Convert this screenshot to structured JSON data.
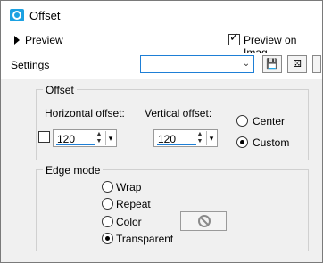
{
  "window": {
    "title": "Offset"
  },
  "top": {
    "preview_toggle": "Preview",
    "preview_on_image": "Preview on Imag",
    "preview_on_image_checked": true
  },
  "settings": {
    "label": "Settings",
    "selected_value": ""
  },
  "offset_group": {
    "legend": "Offset",
    "horizontal_label": "Horizontal offset:",
    "vertical_label": "Vertical offset:",
    "horizontal_value": "120",
    "vertical_value": "120",
    "link_checked": false,
    "options": [
      {
        "label": "Center",
        "selected": false
      },
      {
        "label": "Custom",
        "selected": true
      }
    ]
  },
  "edge_group": {
    "legend": "Edge mode",
    "options": [
      {
        "label": "Wrap",
        "selected": false
      },
      {
        "label": "Repeat",
        "selected": false
      },
      {
        "label": "Color",
        "selected": false
      },
      {
        "label": "Transparent",
        "selected": true
      }
    ]
  }
}
